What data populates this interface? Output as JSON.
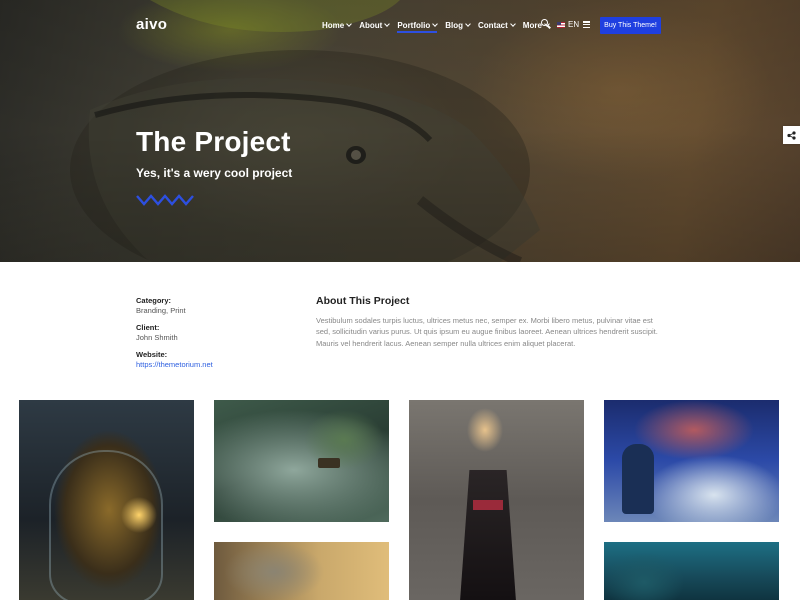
{
  "header": {
    "logo": "aivo",
    "nav": [
      {
        "label": "Home",
        "has_dropdown": true,
        "active": false
      },
      {
        "label": "About",
        "has_dropdown": true,
        "active": false
      },
      {
        "label": "Portfolio",
        "has_dropdown": true,
        "active": true
      },
      {
        "label": "Blog",
        "has_dropdown": true,
        "active": false
      },
      {
        "label": "Contact",
        "has_dropdown": true,
        "active": false
      },
      {
        "label": "More",
        "has_dropdown": true,
        "active": false
      }
    ],
    "language": "EN",
    "buy_button": "Buy This Theme!",
    "accent_color": "#1f3fe0"
  },
  "hero": {
    "title": "The Project",
    "subtitle": "Yes, it's a wery cool project"
  },
  "project": {
    "category_label": "Category:",
    "category_value": "Branding, Print",
    "client_label": "Client:",
    "client_value": "John Shmith",
    "website_label": "Website:",
    "website_value": "https://themetorium.net",
    "about_title": "About This Project",
    "about_body": "Vestibulum sodales turpis luctus, ultrices metus nec, semper ex. Morbi libero metus, pulvinar vitae est sed, sollicitudin varius purus. Ut quis ipsum eu augue finibus laoreet. Aenean ultrices hendrerit suscipit. Mauris vel hendrerit lacus. Aenean semper nulla ultrices enim aliquet placerat."
  },
  "icons": [
    "search-icon",
    "flag-icon",
    "menu-icon",
    "share-icon",
    "chevron-down-icon"
  ]
}
